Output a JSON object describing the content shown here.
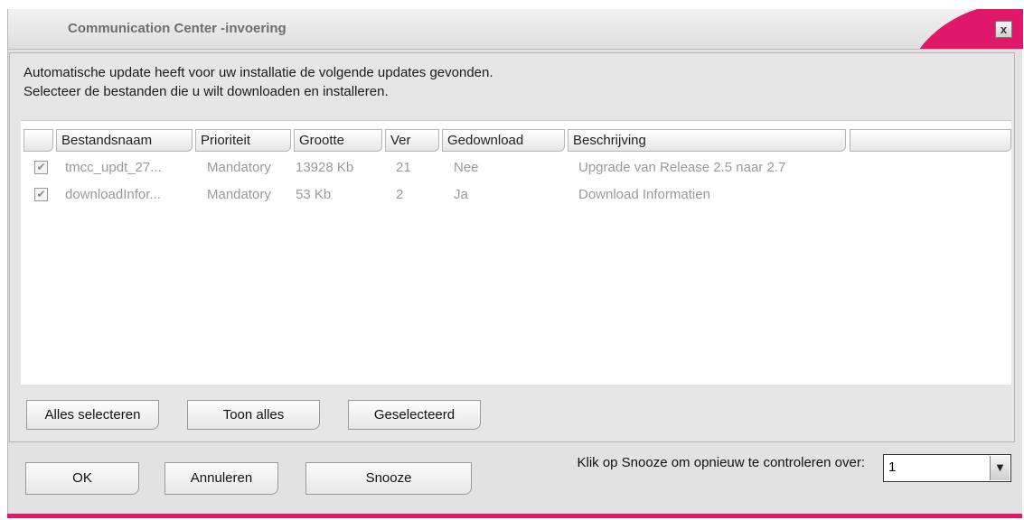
{
  "window": {
    "title": "Communication Center -invoering",
    "close_label": "x"
  },
  "intro": {
    "line1": "Automatische update heeft voor uw installatie de volgende updates gevonden.",
    "line2": "Selecteer de bestanden die u wilt downloaden en installeren."
  },
  "table": {
    "columns": [
      "",
      "Bestandsnaam",
      "Prioriteit",
      "Grootte",
      "Ver",
      "Gedownload",
      "Beschrijving",
      ""
    ],
    "rows": [
      {
        "checked": true,
        "name": "tmcc_updt_27...",
        "priority": "Mandatory",
        "size": "13928 Kb",
        "ver": "21",
        "downloaded": "Nee",
        "description": "Upgrade van Release 2.5 naar 2.7"
      },
      {
        "checked": true,
        "name": "downloadInfor...",
        "priority": "Mandatory",
        "size": "53 Kb",
        "ver": "2",
        "downloaded": "Ja",
        "description": "Download Informatien"
      }
    ]
  },
  "list_buttons": {
    "select_all": "Alles selecteren",
    "show_all": "Toon alles",
    "selected": "Geselecteerd"
  },
  "footer": {
    "ok": "OK",
    "cancel": "Annuleren",
    "snooze": "Snooze",
    "snooze_label": "Klik op Snooze om opnieuw te controleren over:",
    "snooze_value": "1"
  },
  "icons": {
    "close": "close-icon",
    "check": "checkmark-icon",
    "dropdown": "chevron-down-icon"
  },
  "colors": {
    "accent": "#e0186a",
    "window_bg": "#e2e2e2",
    "list_bg": "#ffffff"
  }
}
